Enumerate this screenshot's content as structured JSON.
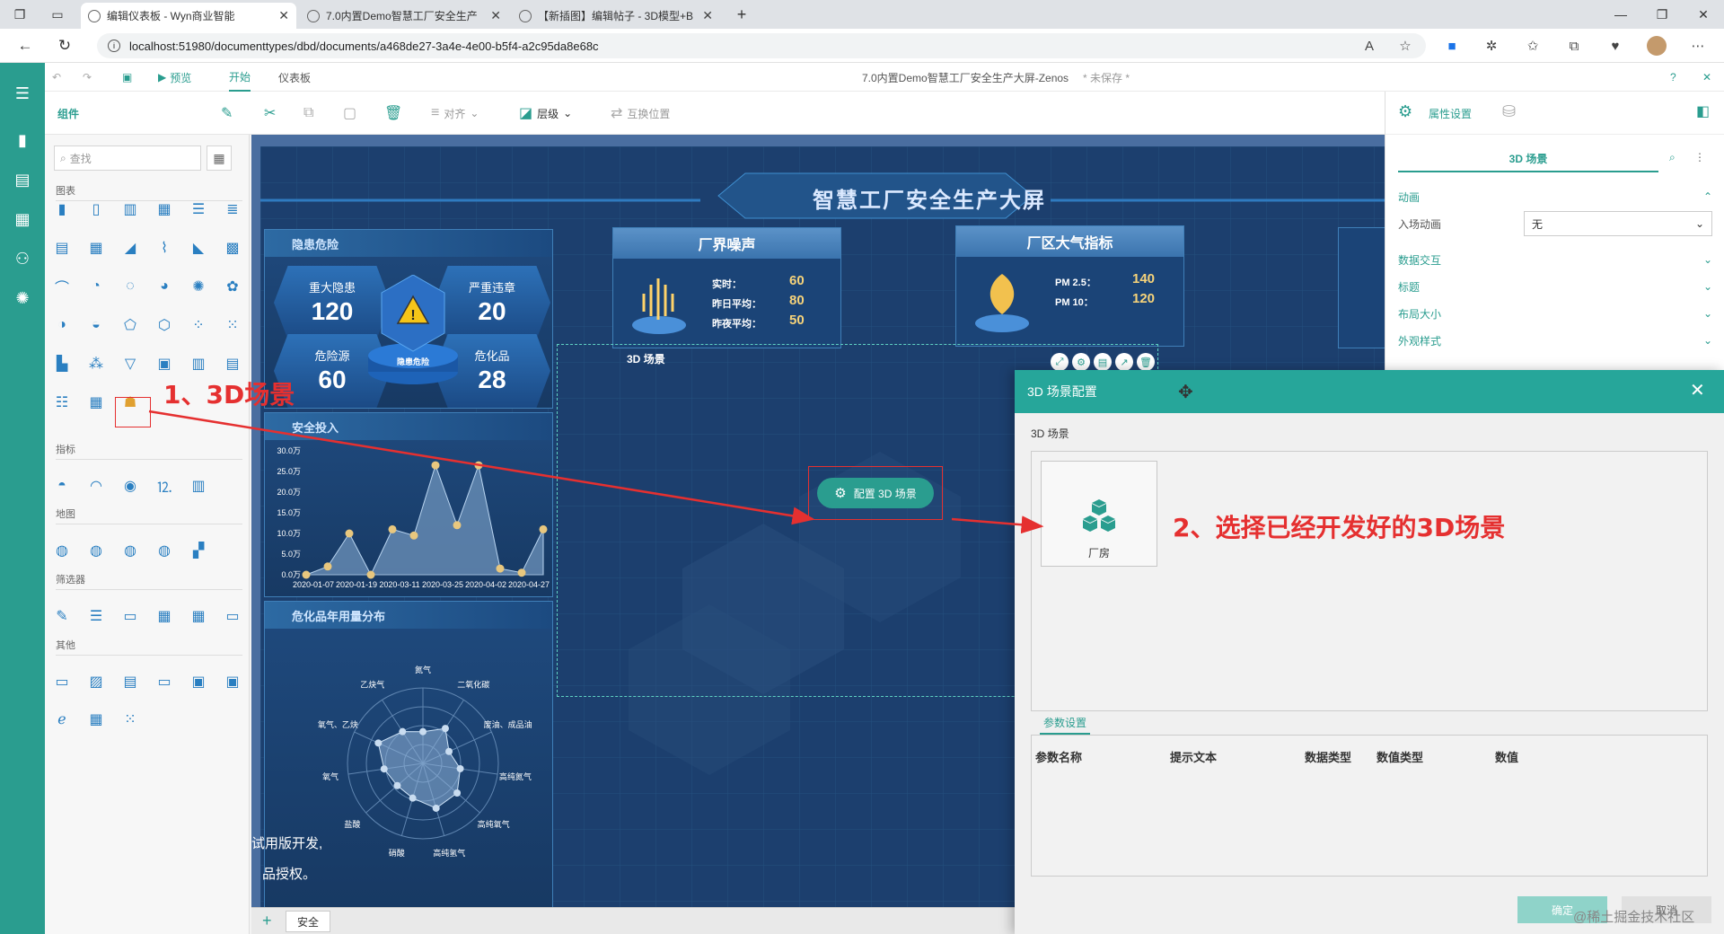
{
  "browser": {
    "tabs": [
      {
        "title": "编辑仪表板 - Wyn商业智能",
        "active": true
      },
      {
        "title": "7.0内置Demo智慧工厂安全生产",
        "active": false
      },
      {
        "title": "【新插图】编辑帖子 - 3D模型+B",
        "active": false
      }
    ],
    "url": "localhost:51980/documenttypes/dbd/documents/a468de27-3a4e-4e00-b5f4-a2c95da8e68c"
  },
  "app": {
    "doc_title": "7.0内置Demo智慧工厂安全生产大屏-Zenos",
    "unsaved": "* 未保存 *",
    "toolbar1": {
      "preview": "预览",
      "start": "开始",
      "dashboard": "仪表板"
    },
    "toolbar2": {
      "components": "组件",
      "align": "对齐",
      "layer": "层级",
      "swap": "互换位置"
    },
    "comp_panel": {
      "search_placeholder": "查找",
      "sections": [
        "图表",
        "指标",
        "地图",
        "筛选器",
        "其他"
      ]
    },
    "right_panel": {
      "tab_props": "属性设置",
      "scene_title": "3D 场景",
      "rows": [
        "动画",
        "入场动画",
        "数据交互",
        "标题",
        "布局大小",
        "外观样式"
      ],
      "entry_anim_value": "无"
    },
    "canvas": {
      "board_title": "智慧工厂安全生产大屏",
      "hazard_title": "隐患危险",
      "hexes": [
        {
          "label": "重大隐患",
          "value": "120"
        },
        {
          "label": "严重违章",
          "value": "20"
        },
        {
          "label": "危险源",
          "value": "60"
        },
        {
          "label": "危化品",
          "value": "28"
        }
      ],
      "pedestal_label": "隐患危险",
      "invest_title": "安全投入",
      "chem_title": "危化品年用量分布",
      "noise": {
        "title": "厂界噪声",
        "rows": [
          {
            "k": "实时：",
            "v": "60"
          },
          {
            "k": "昨日平均：",
            "v": "80"
          },
          {
            "k": "昨夜平均：",
            "v": "50"
          }
        ]
      },
      "air": {
        "title": "厂区大气指标",
        "rows": [
          {
            "k": "PM 2.5：",
            "v": "140"
          },
          {
            "k": "PM 10：",
            "v": "120"
          }
        ]
      },
      "scene_label": "3D 场景",
      "config_btn": "配置 3D 场景",
      "watermark1": "试用版开发,",
      "watermark2": "品授权。",
      "sheet_tab": "安全"
    },
    "dialog": {
      "title": "3D 场景配置",
      "scene_section": "3D 场景",
      "scene_item": "厂房",
      "params_tab": "参数设置",
      "columns": [
        "参数名称",
        "提示文本",
        "数据类型",
        "数值类型",
        "数值"
      ],
      "ok": "确定",
      "cancel": "取消"
    }
  },
  "annotations": {
    "step1": "1、3D场景",
    "step2": "2、选择已经开发好的3D场景",
    "watermark": "@稀土掘金技术社区"
  },
  "chart_data": {
    "type": "area",
    "title": "安全投入",
    "categories": [
      "2020-01-07",
      "2020-01-19",
      "2020-03-11",
      "2020-03-25",
      "2020-04-02",
      "2020-04-27"
    ],
    "x": [
      "2020-01-07",
      "",
      "2020-01-19",
      "",
      "2020-03-11",
      "",
      "2020-03-25",
      "",
      "2020-04-02",
      "",
      "2020-04-27",
      ""
    ],
    "values": [
      0,
      2,
      10,
      0,
      11,
      9.5,
      26.5,
      12,
      26.5,
      1.5,
      0.5,
      11
    ],
    "yticks": [
      "0.0万",
      "5.0万",
      "10.0万",
      "15.0万",
      "20.0万",
      "25.0万",
      "30.0万"
    ],
    "ylim": [
      0,
      30
    ]
  },
  "radar_data": {
    "type": "radar",
    "labels": [
      "氮气",
      "二氧化碳",
      "废油、成品油",
      "高纯氮气",
      "高纯氧气",
      "高纯氢气",
      "硝酸",
      "盐酸",
      "氧气",
      "氧气、乙炔",
      "乙炔气"
    ]
  },
  "colors": {
    "teal": "#2a9d8f",
    "dialog_teal": "#26a69a",
    "board": "#1c3f6e",
    "annotation": "#e53030"
  }
}
